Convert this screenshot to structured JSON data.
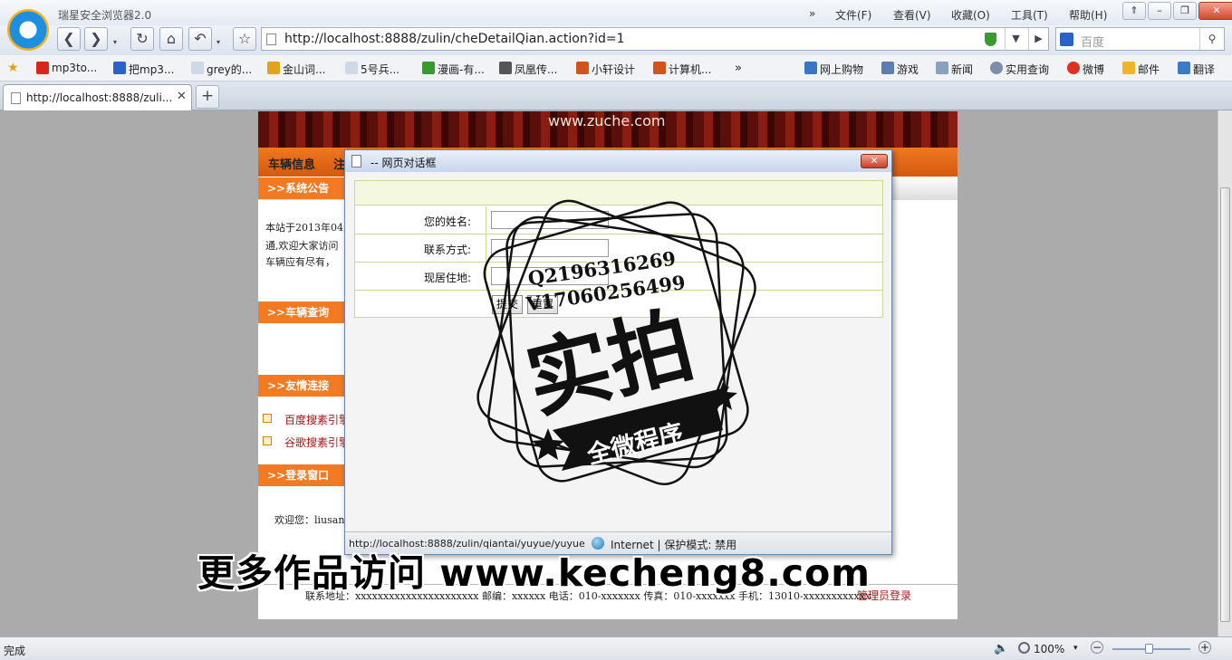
{
  "app": {
    "title": "瑞星安全浏览器2.0"
  },
  "menu": {
    "more": "»",
    "items": [
      "文件(F)",
      "查看(V)",
      "收藏(O)",
      "工具(T)",
      "帮助(H)"
    ]
  },
  "window_controls": {
    "pin": "⇑",
    "minimize": "–",
    "restore": "❐",
    "close": "✕"
  },
  "toolbar": {
    "back": "❮",
    "forward": "❯",
    "refresh": "↻",
    "home": "⌂",
    "undo": "↶",
    "favorite": "☆",
    "dropdown": "▾"
  },
  "address": {
    "url": "http://localhost:8888/zulin/cheDetailQian.action?id=1",
    "dropdown": "▼",
    "go": "▶"
  },
  "search": {
    "placeholder": "百度",
    "button": "⚲"
  },
  "bookmarks": {
    "left": [
      "mp3to...",
      "把mp3...",
      "grey的...",
      "金山词...",
      "5号兵...",
      "漫画-有...",
      "凤凰传...",
      "小轩设计",
      "计算机..."
    ],
    "more": "»",
    "right": [
      "网上购物",
      "游戏",
      "新闻",
      "实用查询",
      "微博",
      "邮件",
      "翻译"
    ]
  },
  "tab": {
    "label": "http://localhost:8888/zuli...",
    "close": "✕",
    "new": "+"
  },
  "page": {
    "banner": "www.zuche.com",
    "nav": [
      "车辆信息",
      "注"
    ],
    "sections": {
      "notice": ">>系统公告",
      "query": ">>车辆查询",
      "links": ">>友情连接",
      "login": ">>登录窗口"
    },
    "notice_lines": [
      "本站于2013年04,",
      "通,欢迎大家访问",
      "车辆应有尽有，"
    ],
    "links": [
      "百度搜素引擎",
      "谷歌搜素引擎"
    ],
    "welcome": "欢迎您：liusan",
    "footer": "联系地址：xxxxxxxxxxxxxxxxxxxxxx   邮编：xxxxxx 电话：010-xxxxxxx   传真：010-xxxxxxx   手机：13010-xxxxxxxxxxxx",
    "admin_login": "管理员登录"
  },
  "dialog": {
    "title": "-- 网页对话框",
    "close": "✕",
    "fields": [
      {
        "label": "您的姓名:",
        "value": ""
      },
      {
        "label": "联系方式:",
        "value": ""
      },
      {
        "label": "现居住地:",
        "value": ""
      }
    ],
    "submit": "提交",
    "reset": "重置",
    "status_url": "http://localhost:8888/zulin/qiantai/yuyue/yuyue",
    "zone": "Internet | 保护模式: 禁用"
  },
  "watermark": {
    "qq": "Q2196316269",
    "wechat": "V17060256499",
    "main": "实拍",
    "ribbon": "全微程序",
    "site": "更多作品访问 www.kecheng8.com"
  },
  "statusbar": {
    "text": "完成",
    "sound": "🔈",
    "zoom": "100%",
    "zoom_dropdown": "▾",
    "zoom_minus": "−",
    "zoom_plus": "+"
  }
}
